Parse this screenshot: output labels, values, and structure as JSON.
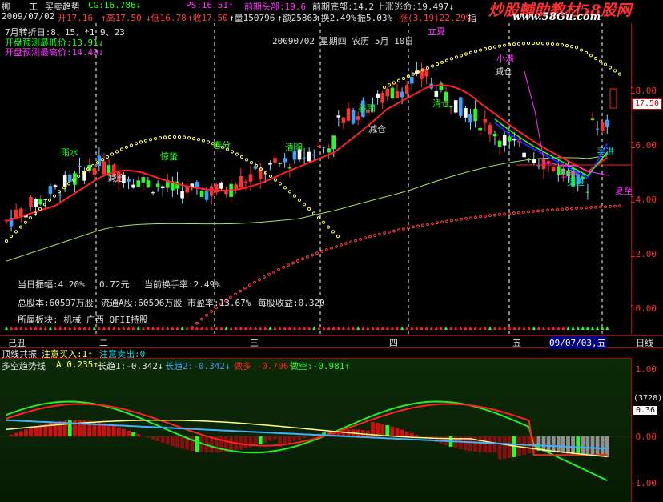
{
  "topbar": {
    "symbol": "柳",
    "mode": "工",
    "indicator_name": "买卖趋势",
    "cg": "CG:16.786↓",
    "ps": "PS:16.51↑",
    "front_top": "前期头部:19.6",
    "front_bottom": "前期底部:14.2",
    "escape": "上涨逃命:19.497↓",
    "watermark_title": "炒股輔助教材58股网",
    "watermark_url": "www.58Gu.com"
  },
  "infobar": {
    "date": "2009/07/02",
    "open": "开17.16",
    "high": "↑高17.50",
    "low": "↓低16.78",
    "close": "↑收17.50",
    "volume": "↑量150796",
    "amount": "↑额25863",
    "turnover": "↑换2.49%",
    "amplitude": "振5.03%",
    "change": "涨(3.19)22.29%",
    "index": "指"
  },
  "main": {
    "turn_label": "7月转折日:8、15、*1 9、23",
    "open_low": "开盘预测最低价:13.91↓",
    "open_high": "开盘预测最高价:14.49↓",
    "date_info": "20090702 星期四 农历 5月 10日",
    "terms": [
      "雨水",
      "惊蛰",
      "春分",
      "清明",
      "谷雨",
      "立夏",
      "小满",
      "芒种",
      "夏至"
    ],
    "signals": [
      "减仓",
      "减仓",
      "减仓",
      "买进",
      "买进",
      "清仓",
      "持仓",
      "减仓"
    ],
    "stats": {
      "line1_a": "当日振幅:4.20%",
      "line1_b": "0.72元",
      "line1_c": "当前换手率:2.49%",
      "line2_a": "总股本:60597万股",
      "line2_b": "流通A股:60596万股",
      "line2_c": "市盈率:13.67%",
      "line2_d": "每股收益:0.320",
      "line3": "所属板块: 机械 广西 QFII持股"
    },
    "price_tag": "17.50",
    "y_ticks": [
      "18.00",
      "16.00",
      "14.00",
      "12.00",
      "10.00"
    ]
  },
  "datestrip": {
    "labels": [
      "己丑",
      "二",
      "三",
      "四",
      "五",
      "09/07/03,五"
    ],
    "right_label": "日线"
  },
  "signalbar": {
    "a": "顶线共振",
    "b": "注意买入:1↑",
    "c": "注意卖出:0"
  },
  "sub": {
    "name": "多空趋势线",
    "a": "A 0.235↑",
    "long1": "长趋1:-0.342↓",
    "long2": "长趋2:-0.342↓",
    "bull": "做多 -0.706↑",
    "bear": "做空:-0.981↑",
    "y_ticks": [
      "1.00",
      "0.00",
      "-1.00"
    ],
    "count": "(3728)",
    "value": "0.36"
  },
  "colors": {
    "up": "#ff2020",
    "down": "#22ff22",
    "axis": "#ff3030",
    "bg": "#000000"
  }
}
